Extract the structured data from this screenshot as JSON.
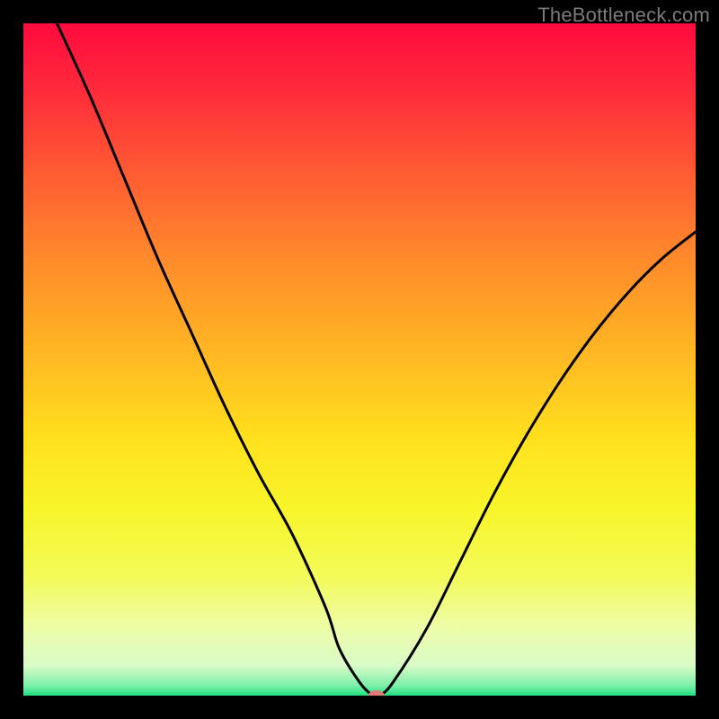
{
  "watermark": "TheBottleneck.com",
  "chart_data": {
    "type": "line",
    "title": "",
    "xlabel": "",
    "ylabel": "",
    "xlim": [
      0,
      100
    ],
    "ylim": [
      0,
      100
    ],
    "grid": false,
    "curve": {
      "name": "bottleneck-curve",
      "color": "#000000",
      "x": [
        5,
        10,
        15,
        20,
        25,
        30,
        35,
        40,
        45,
        47,
        50,
        52,
        53,
        55,
        60,
        65,
        70,
        75,
        80,
        85,
        90,
        95,
        100
      ],
      "y": [
        100,
        89,
        77,
        65,
        54,
        43,
        33,
        24,
        13,
        7,
        2,
        0,
        0,
        2,
        10,
        20,
        30,
        39,
        47,
        54,
        60,
        65,
        69
      ]
    },
    "marker": {
      "x": 52.5,
      "y": 0,
      "rx": 9,
      "ry": 6,
      "color": "#e27a78"
    },
    "background_gradient": {
      "stops": [
        {
          "offset": 0.0,
          "color": "#ff0b3f"
        },
        {
          "offset": 0.1,
          "color": "#ff2b3b"
        },
        {
          "offset": 0.22,
          "color": "#ff5a33"
        },
        {
          "offset": 0.35,
          "color": "#ff8a2b"
        },
        {
          "offset": 0.5,
          "color": "#ffba23"
        },
        {
          "offset": 0.62,
          "color": "#ffe11d"
        },
        {
          "offset": 0.72,
          "color": "#f8f52a"
        },
        {
          "offset": 0.82,
          "color": "#f3fb57"
        },
        {
          "offset": 0.9,
          "color": "#eefda8"
        },
        {
          "offset": 0.955,
          "color": "#d9fbc8"
        },
        {
          "offset": 0.985,
          "color": "#7df0a8"
        },
        {
          "offset": 1.0,
          "color": "#1fe082"
        }
      ]
    }
  }
}
